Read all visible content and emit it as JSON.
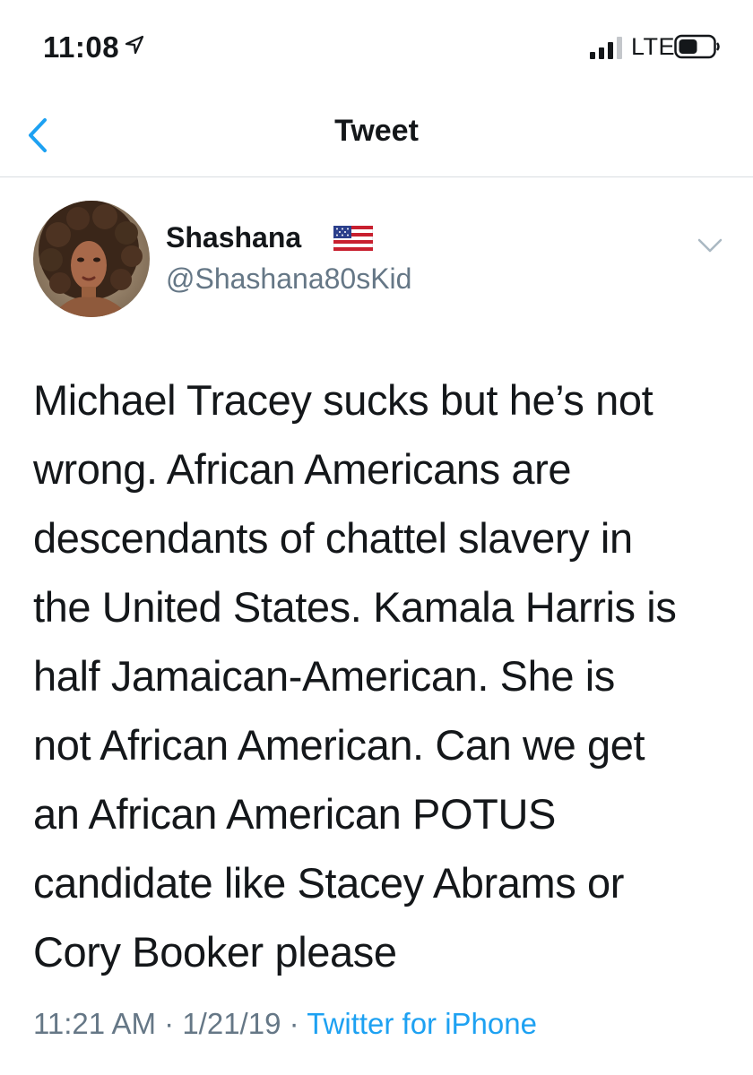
{
  "status_bar": {
    "time": "11:08",
    "network": "LTE",
    "icons": [
      "location-arrow-icon",
      "signal-icon",
      "battery-icon"
    ]
  },
  "nav": {
    "title": "Tweet",
    "back_icon": "chevron-left-icon"
  },
  "tweet": {
    "author": {
      "display_name": "Shashana",
      "handle": "@Shashana80sKid",
      "badge_icon": "us-flag-icon"
    },
    "text": "Michael Tracey sucks but he’s not\nwrong. African Americans are\ndescendants of chattel slavery in\nthe United States. Kamala Harris is\nhalf Jamaican-American. She is\nnot African American. Can we get\nan African American POTUS\ncandidate like Stacey Abrams or\nCory Booker please",
    "time": "11:21 AM",
    "date": "1/21/19",
    "separator": "·",
    "source": "Twitter for iPhone",
    "menu_icon": "chevron-down-icon"
  },
  "colors": {
    "accent": "#1da1f2",
    "secondary_text": "#657786",
    "primary_text": "#14171a",
    "divider": "#d8dde1"
  }
}
